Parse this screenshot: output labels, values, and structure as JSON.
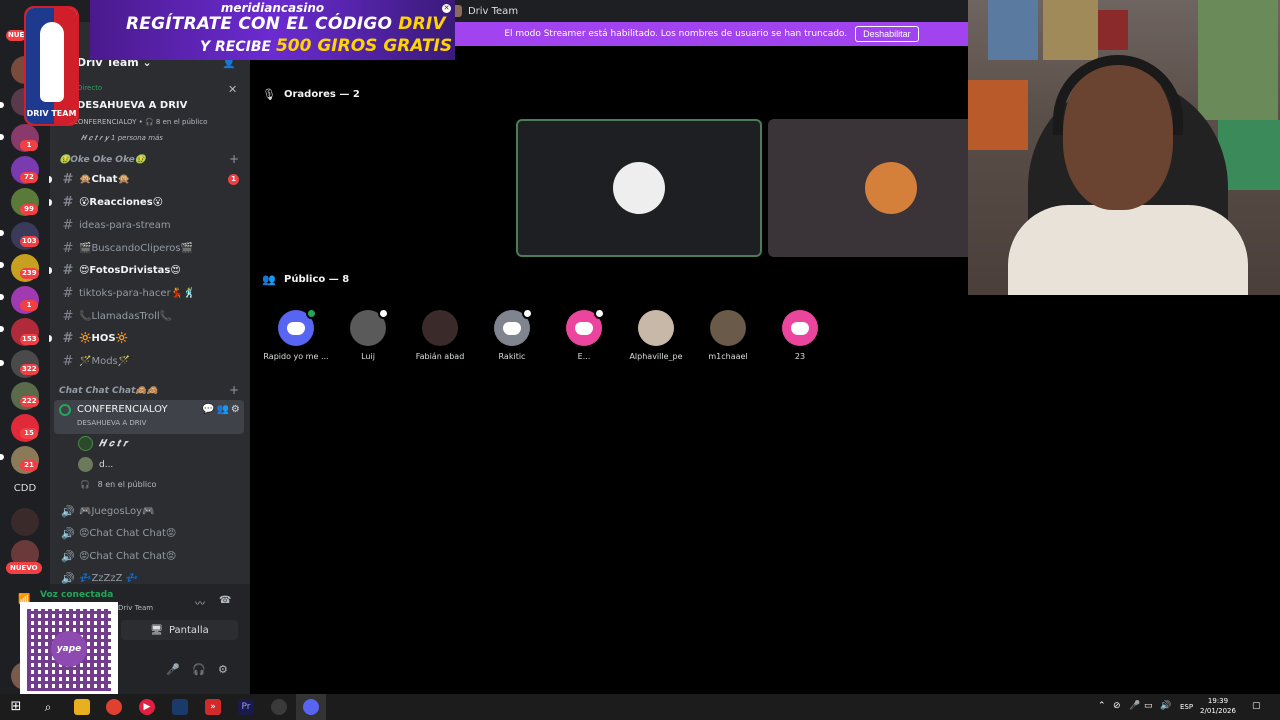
{
  "window": {
    "title": "Driv Team"
  },
  "sponsor": {
    "brand": "meridiancasino",
    "line1_a": "REGÍTRATE CON EL CÓDIGO",
    "line1_b": "DRIV",
    "line2_a": "Y RECIBE",
    "line2_b": "500 GIROS GRATIS"
  },
  "logo": {
    "text": "DRIV TEAM"
  },
  "streamer_banner": {
    "text": "El modo Streamer está habilitado. Los nombres de usuario se han truncado.",
    "button": "Deshabilitar"
  },
  "server_rail": {
    "badges": [
      "NUE",
      "1",
      "72",
      "99",
      "103",
      "239",
      "1",
      "153",
      "322",
      "222",
      "15",
      "21"
    ],
    "cdd": "CDD",
    "nuevo": "NUEVO"
  },
  "server": {
    "name": "Driv Team"
  },
  "live_event": {
    "label": "Directo",
    "title": "DESAHUEVA A DRIV",
    "sub": "CONFERENCIALOY • 🎧 8 en el público",
    "people": "𝑯 𝒄 𝒕 𝒓 𝒚 1 persona más"
  },
  "categories": {
    "oke": "🤢Oke Oke Oke🤢",
    "chatchat": "Chat Chat Chat🙈🙈"
  },
  "channels": [
    {
      "name": "🙊Chat🙊",
      "badge": "1"
    },
    {
      "name": "😮Reacciones😮"
    },
    {
      "name": "ideas-para-stream"
    },
    {
      "name": "🎬BuscandoCliperos🎬"
    },
    {
      "name": "😍FotosDrivistas😍"
    },
    {
      "name": "tiktoks-para-hacer💃🕺"
    },
    {
      "name": "📞LlamadasTroll📞"
    },
    {
      "name": "🔆HOS🔆"
    },
    {
      "name": "🪄Mods🪄"
    }
  ],
  "stage_channel": {
    "name": "CONFERENCIALOY",
    "topic": "DESAHUEVA A DRIV",
    "actions": "💬👥⚙"
  },
  "stage_members": [
    "𝑯 𝒄 𝒕 𝒓",
    "d..."
  ],
  "stage_audience": "8 en el público",
  "voice_channels": [
    "🎮JuegosLoy🎮",
    "😡Chat Chat Chat😡",
    "😡Chat Chat Chat😡",
    "💤ZzZzZ 💤"
  ],
  "voice_panel": {
    "status": "Voz conectada",
    "sub": "Driv Team",
    "screen": "Pantalla"
  },
  "qr": {
    "label": "yape"
  },
  "stage": {
    "speakers_title": "Oradores — 2",
    "audience_title": "Público — 8",
    "audience": [
      "Rapido yo me ...",
      "Luij",
      "Fabián abad",
      "Rakitic",
      "E...",
      "Alphaville_pe",
      "m1chaael",
      "23"
    ]
  },
  "tray": {
    "lang": "ESP",
    "time": "19:39",
    "date": "2/01/2026"
  },
  "colors": {
    "accent": "#a144f0",
    "green": "#23a55a",
    "red": "#f23f43",
    "blurple": "#5865f2"
  }
}
